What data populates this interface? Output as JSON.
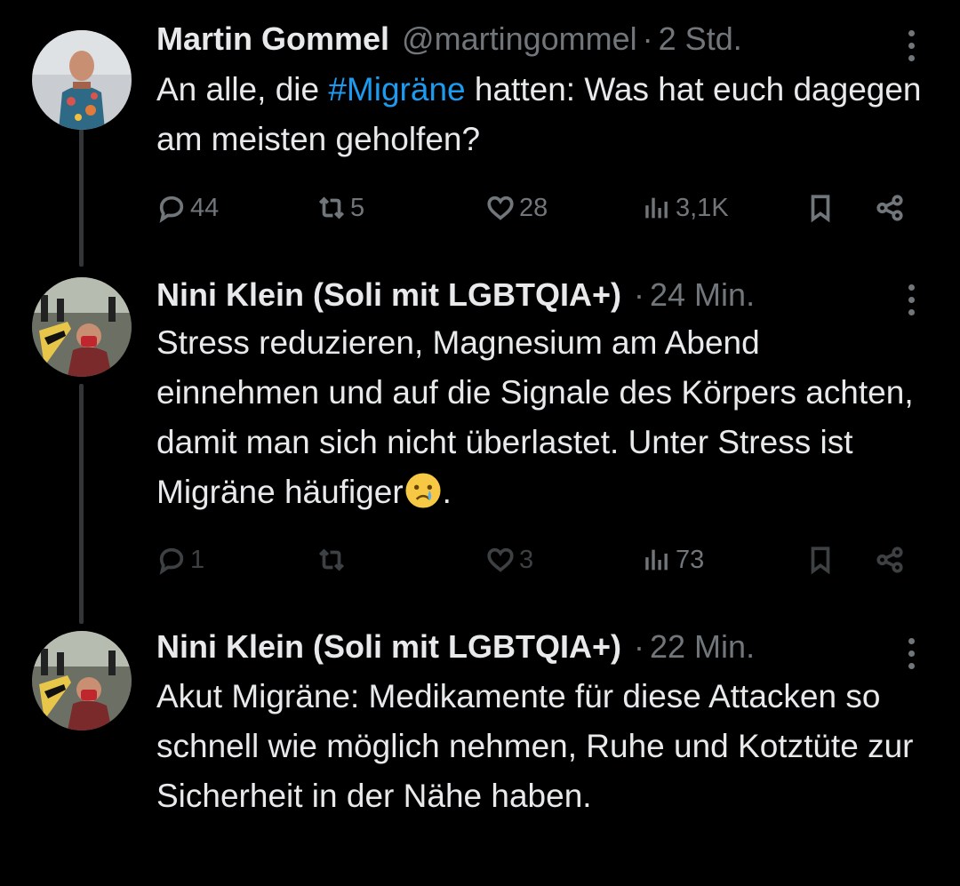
{
  "tweets": [
    {
      "name": "Martin Gommel",
      "handle": "@martingommel",
      "separator": "·",
      "time": "2 Std.",
      "text_before": "An alle, die ",
      "hashtag": "#Migräne",
      "text_after": " hatten: Was hat euch dagegen am meisten geholfen?",
      "replies": "44",
      "retweets": "5",
      "likes": "28",
      "views": "3,1K"
    },
    {
      "name": "Nini Klein (Soli mit LGBTQIA+)",
      "separator": "·",
      "time": "24 Min.",
      "text": "Stress reduzieren, Magnesium am Abend einnehmen und auf die Signale des Körpers achten, damit man sich nicht überlastet. Unter Stress ist Migräne häufiger",
      "text_end": ".",
      "emoji_name": "crying-face-emoji",
      "replies": "1",
      "retweets": "",
      "likes": "3",
      "views": "73"
    },
    {
      "name": "Nini Klein (Soli mit LGBTQIA+)",
      "separator": "·",
      "time": "22 Min.",
      "text": "Akut Migräne: Medikamente für diese Attacken so schnell wie möglich nehmen, Ruhe und Kotztüte zur Sicherheit in der Nähe haben."
    }
  ],
  "colors": {
    "background": "#000000",
    "text": "#e7e9ea",
    "secondary": "#71767b",
    "hashtag": "#1d9bf0",
    "thread_line": "#333639"
  },
  "icons": [
    "reply-icon",
    "retweet-icon",
    "like-icon",
    "views-icon",
    "bookmark-icon",
    "share-icon",
    "more-icon"
  ]
}
